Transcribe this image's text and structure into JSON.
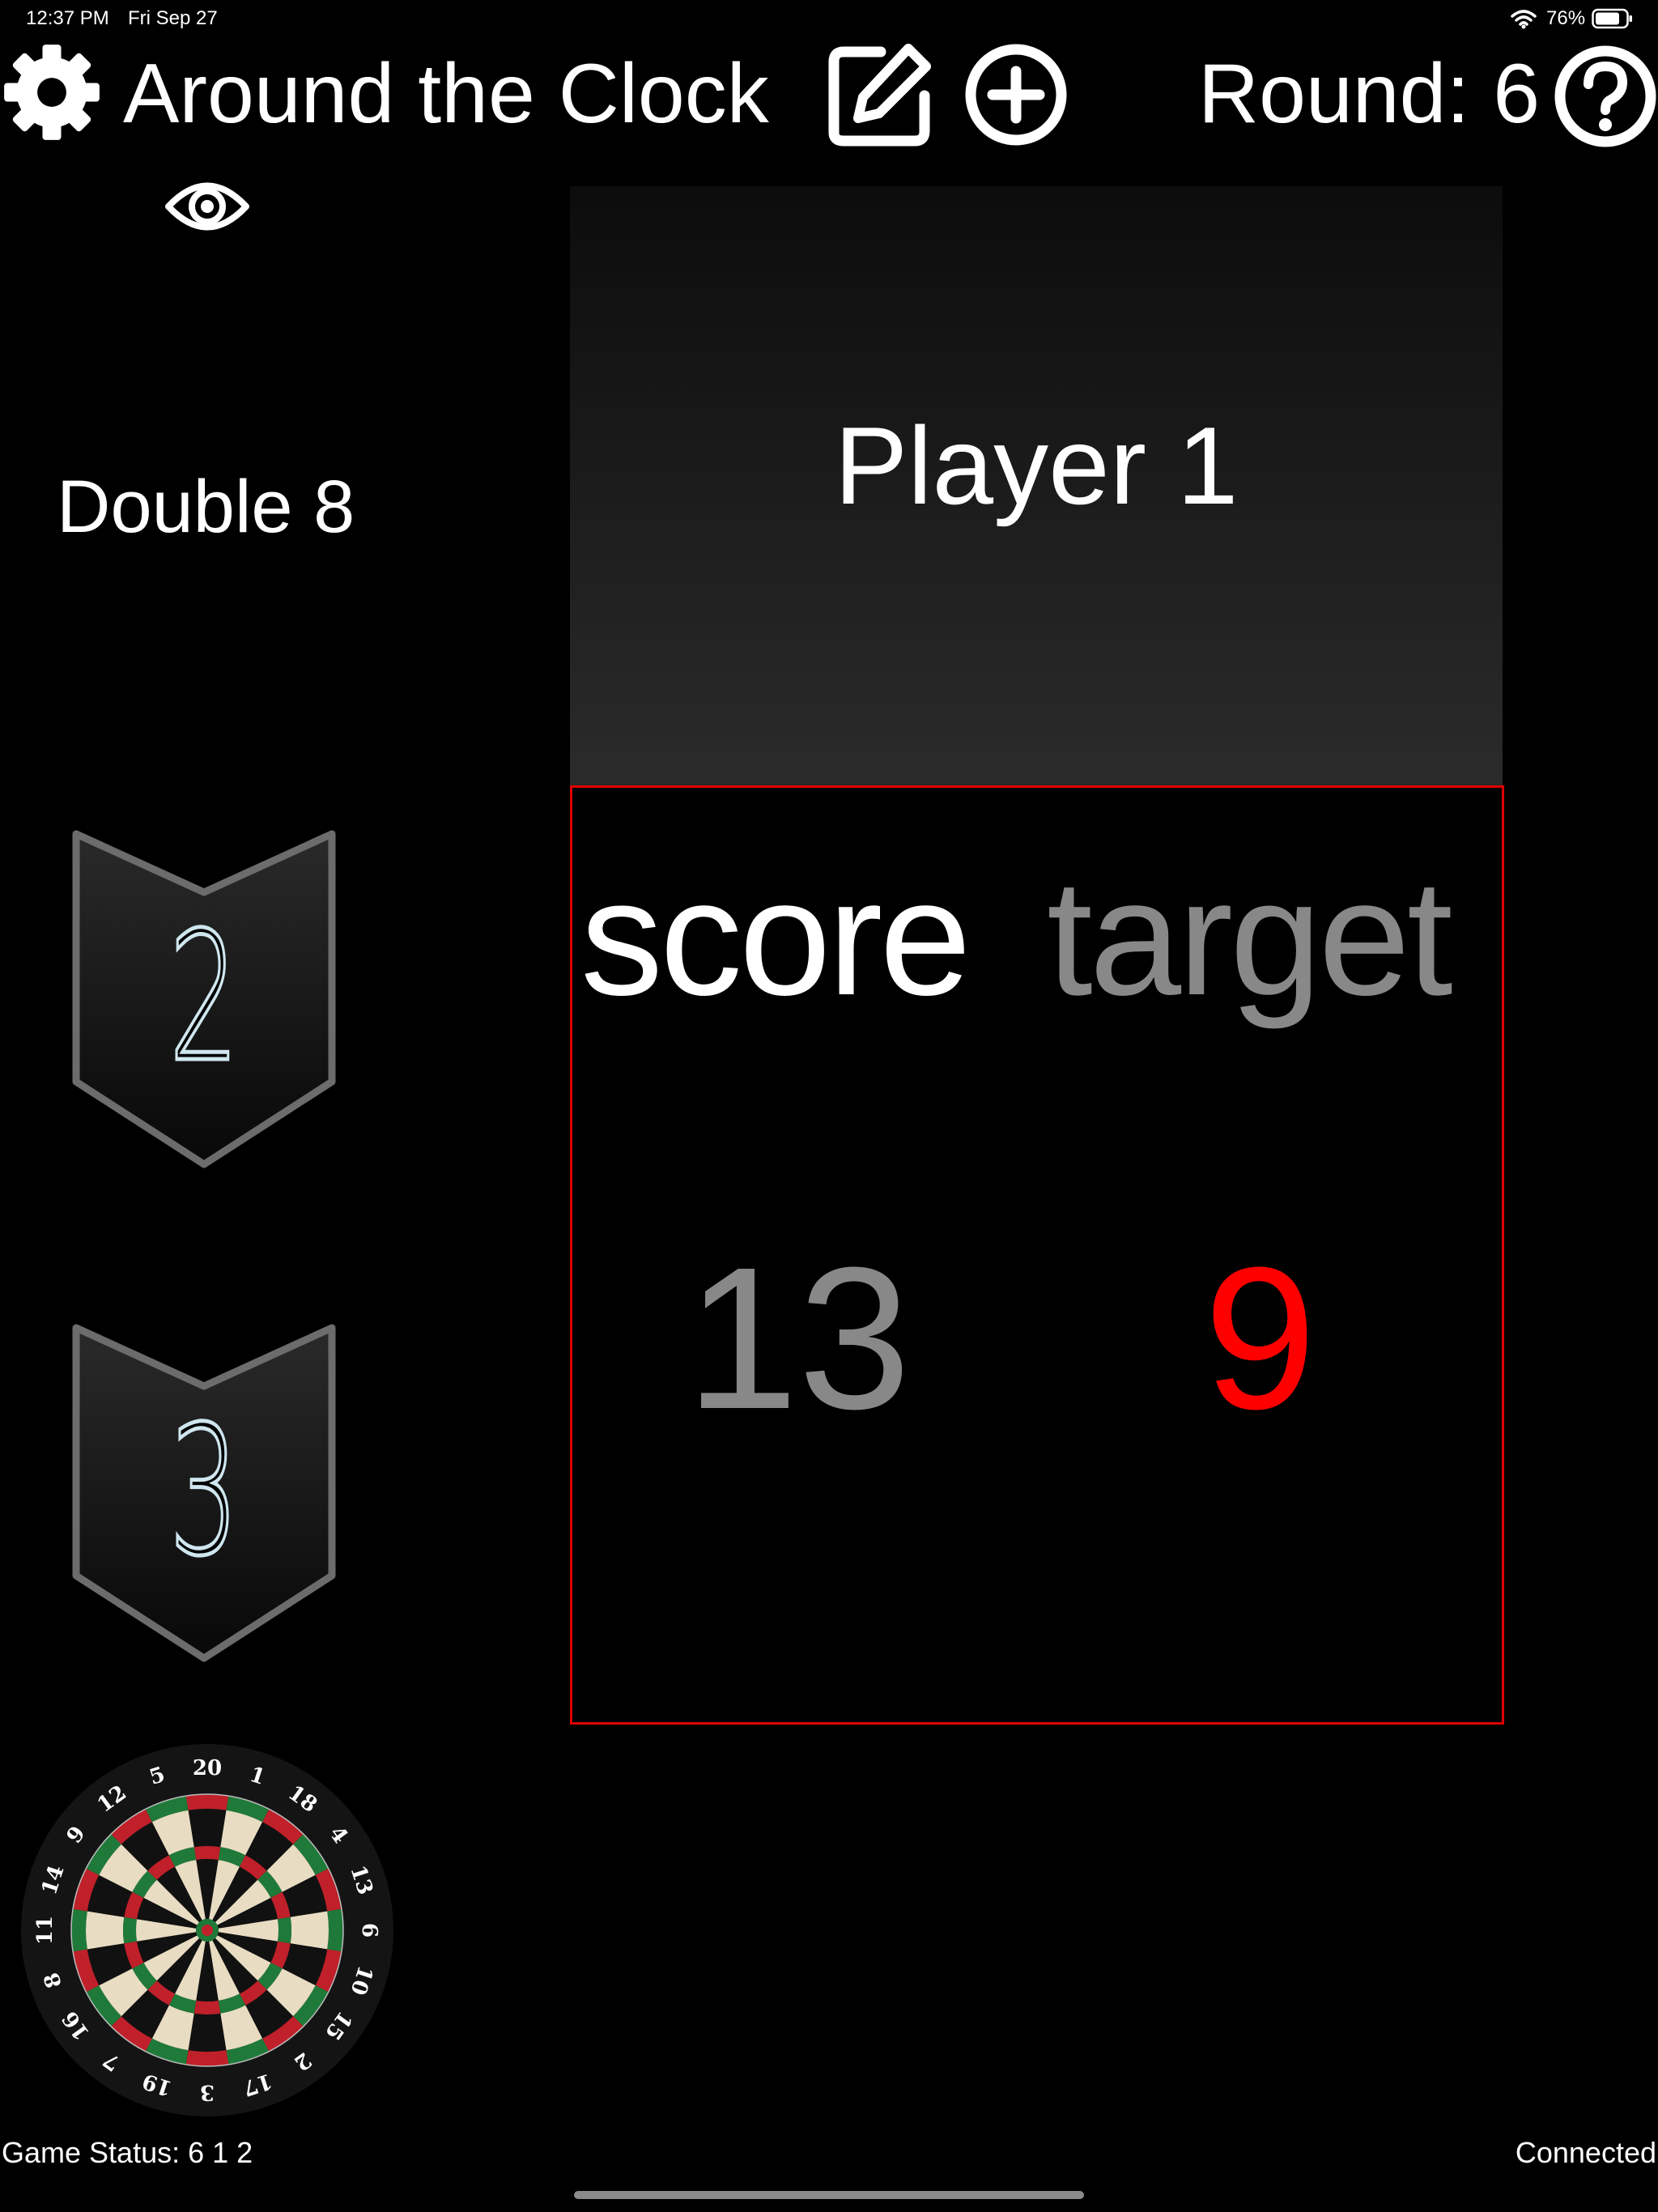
{
  "status_bar": {
    "time": "12:37 PM",
    "date": "Fri Sep 27",
    "battery": "76%",
    "wifi_icon": "wifi-icon",
    "battery_icon": "battery-icon"
  },
  "header": {
    "title": "Around the Clock",
    "round": "Round: 6",
    "settings_icon": "gear-icon",
    "edit_icon": "edit-icon",
    "add_icon": "plus-circle-icon",
    "help_icon": "help-circle-icon",
    "visibility_icon": "eye-icon"
  },
  "target_label": "Double 8",
  "badges": [
    {
      "number": "2"
    },
    {
      "number": "3"
    }
  ],
  "player": {
    "name": "Player 1"
  },
  "score_panel": {
    "score_label": "score",
    "target_label": "target",
    "score_value": "13",
    "target_value": "9",
    "border_color": "#e00000",
    "target_color": "#ff0000"
  },
  "dartboard": {
    "numbers": [
      "20",
      "1",
      "18",
      "4",
      "13",
      "6",
      "10",
      "15",
      "2",
      "17",
      "3",
      "19",
      "7",
      "16",
      "8",
      "11",
      "14",
      "9",
      "12",
      "5"
    ]
  },
  "footer": {
    "game_status": "Game Status: 6 1 2",
    "connection": "Connected"
  }
}
